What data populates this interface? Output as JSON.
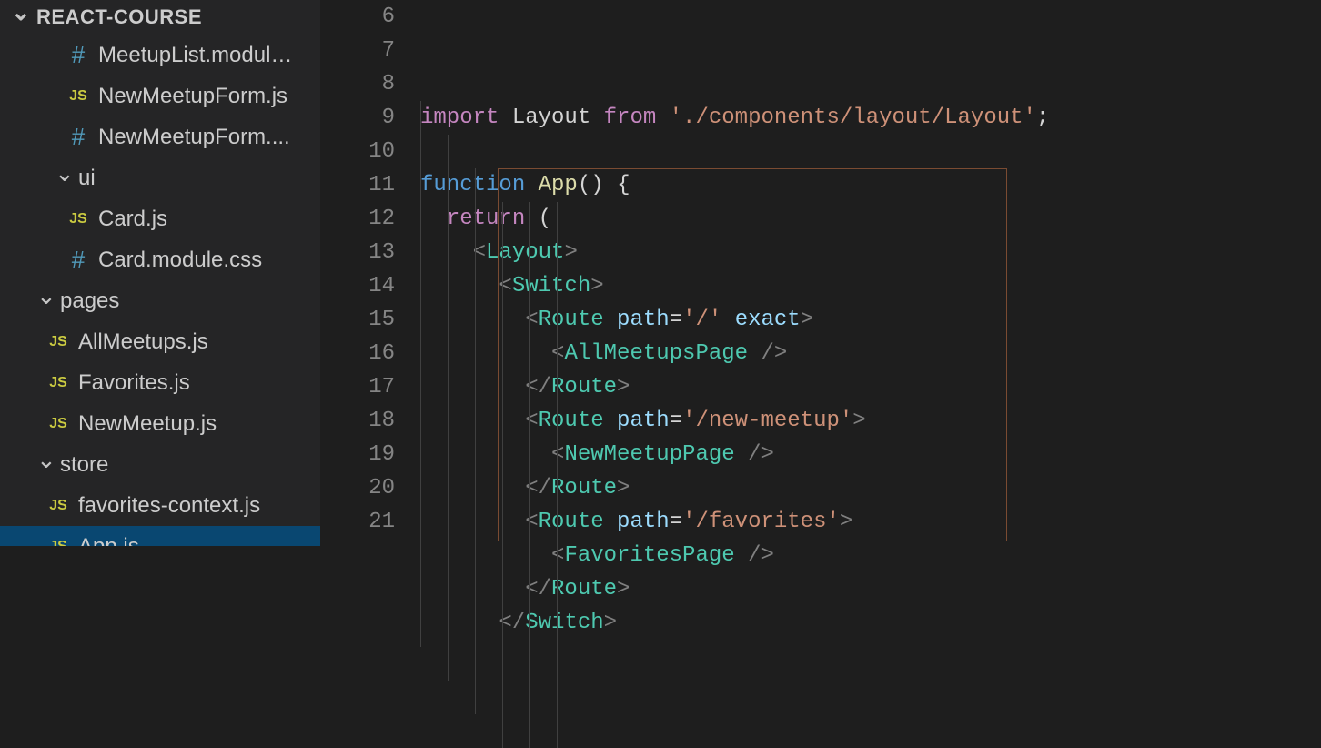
{
  "sidebar": {
    "projectName": "REACT-COURSE",
    "items": [
      {
        "type": "file",
        "icon": "hash",
        "indent": 1,
        "label": "MeetupList.modul…"
      },
      {
        "type": "file",
        "icon": "js",
        "indent": 1,
        "label": "NewMeetupForm.js"
      },
      {
        "type": "file",
        "icon": "hash",
        "indent": 1,
        "label": "NewMeetupForm...."
      },
      {
        "type": "folder",
        "icon": "chev",
        "indent": 2,
        "label": "ui"
      },
      {
        "type": "file",
        "icon": "js",
        "indent": 1,
        "label": "Card.js"
      },
      {
        "type": "file",
        "icon": "hash",
        "indent": 1,
        "label": "Card.module.css"
      },
      {
        "type": "folder",
        "icon": "chev",
        "indent": 1,
        "label": "pages"
      },
      {
        "type": "file",
        "icon": "js",
        "indent": 2,
        "label": "AllMeetups.js"
      },
      {
        "type": "file",
        "icon": "js",
        "indent": 2,
        "label": "Favorites.js"
      },
      {
        "type": "file",
        "icon": "js",
        "indent": 2,
        "label": "NewMeetup.js"
      },
      {
        "type": "folder",
        "icon": "chev",
        "indent": 1,
        "label": "store"
      },
      {
        "type": "file",
        "icon": "js",
        "indent": 2,
        "label": "favorites-context.js"
      },
      {
        "type": "file",
        "icon": "js",
        "indent": 2,
        "label": "App.js",
        "selected": true
      }
    ]
  },
  "editor": {
    "firstLine": 6,
    "lines": [
      [
        [
          "tk-purple",
          "import"
        ],
        [
          "tk-white",
          " Layout "
        ],
        [
          "tk-purple",
          "from"
        ],
        [
          "tk-white",
          " "
        ],
        [
          "tk-string",
          "'./components/layout/Layout'"
        ],
        [
          "tk-white",
          ";"
        ]
      ],
      [],
      [
        [
          "tk-keyword",
          "function"
        ],
        [
          "tk-white",
          " "
        ],
        [
          "tk-func",
          "App"
        ],
        [
          "tk-white",
          "() "
        ],
        [
          "tk-brace",
          "{"
        ]
      ],
      [
        [
          "tk-white",
          "  "
        ],
        [
          "tk-purple",
          "return"
        ],
        [
          "tk-white",
          " ("
        ]
      ],
      [
        [
          "tk-white",
          "    "
        ],
        [
          "tk-punct",
          "<"
        ],
        [
          "tk-comp",
          "Layout"
        ],
        [
          "tk-punct",
          ">"
        ]
      ],
      [
        [
          "tk-white",
          "      "
        ],
        [
          "tk-punct",
          "<"
        ],
        [
          "tk-comp",
          "Switch"
        ],
        [
          "tk-punct",
          ">"
        ]
      ],
      [
        [
          "tk-white",
          "        "
        ],
        [
          "tk-punct",
          "<"
        ],
        [
          "tk-comp",
          "Route"
        ],
        [
          "tk-white",
          " "
        ],
        [
          "tk-attr",
          "path"
        ],
        [
          "tk-white",
          "="
        ],
        [
          "tk-string",
          "'/'"
        ],
        [
          "tk-white",
          " "
        ],
        [
          "tk-attr",
          "exact"
        ],
        [
          "tk-punct",
          ">"
        ]
      ],
      [
        [
          "tk-white",
          "          "
        ],
        [
          "tk-punct",
          "<"
        ],
        [
          "tk-comp",
          "AllMeetupsPage"
        ],
        [
          "tk-white",
          " "
        ],
        [
          "tk-punct",
          "/>"
        ]
      ],
      [
        [
          "tk-white",
          "        "
        ],
        [
          "tk-punct",
          "</"
        ],
        [
          "tk-comp",
          "Route"
        ],
        [
          "tk-punct",
          ">"
        ]
      ],
      [
        [
          "tk-white",
          "        "
        ],
        [
          "tk-punct",
          "<"
        ],
        [
          "tk-comp",
          "Route"
        ],
        [
          "tk-white",
          " "
        ],
        [
          "tk-attr",
          "path"
        ],
        [
          "tk-white",
          "="
        ],
        [
          "tk-string",
          "'/new-meetup'"
        ],
        [
          "tk-punct",
          ">"
        ]
      ],
      [
        [
          "tk-white",
          "          "
        ],
        [
          "tk-punct",
          "<"
        ],
        [
          "tk-comp",
          "NewMeetupPage"
        ],
        [
          "tk-white",
          " "
        ],
        [
          "tk-punct",
          "/>"
        ]
      ],
      [
        [
          "tk-white",
          "        "
        ],
        [
          "tk-punct",
          "</"
        ],
        [
          "tk-comp",
          "Route"
        ],
        [
          "tk-punct",
          ">"
        ]
      ],
      [
        [
          "tk-white",
          "        "
        ],
        [
          "tk-punct",
          "<"
        ],
        [
          "tk-comp",
          "Route"
        ],
        [
          "tk-white",
          " "
        ],
        [
          "tk-attr",
          "path"
        ],
        [
          "tk-white",
          "="
        ],
        [
          "tk-string",
          "'/favorites'"
        ],
        [
          "tk-punct",
          ">"
        ]
      ],
      [
        [
          "tk-white",
          "          "
        ],
        [
          "tk-punct",
          "<"
        ],
        [
          "tk-comp",
          "FavoritesPage"
        ],
        [
          "tk-white",
          " "
        ],
        [
          "tk-punct",
          "/>"
        ]
      ],
      [
        [
          "tk-white",
          "        "
        ],
        [
          "tk-punct",
          "</"
        ],
        [
          "tk-comp",
          "Route"
        ],
        [
          "tk-punct",
          ">"
        ]
      ],
      [
        [
          "tk-white",
          "      "
        ],
        [
          "tk-punct",
          "</"
        ],
        [
          "tk-comp",
          "Switch"
        ],
        [
          "tk-punct",
          ">"
        ]
      ]
    ]
  }
}
